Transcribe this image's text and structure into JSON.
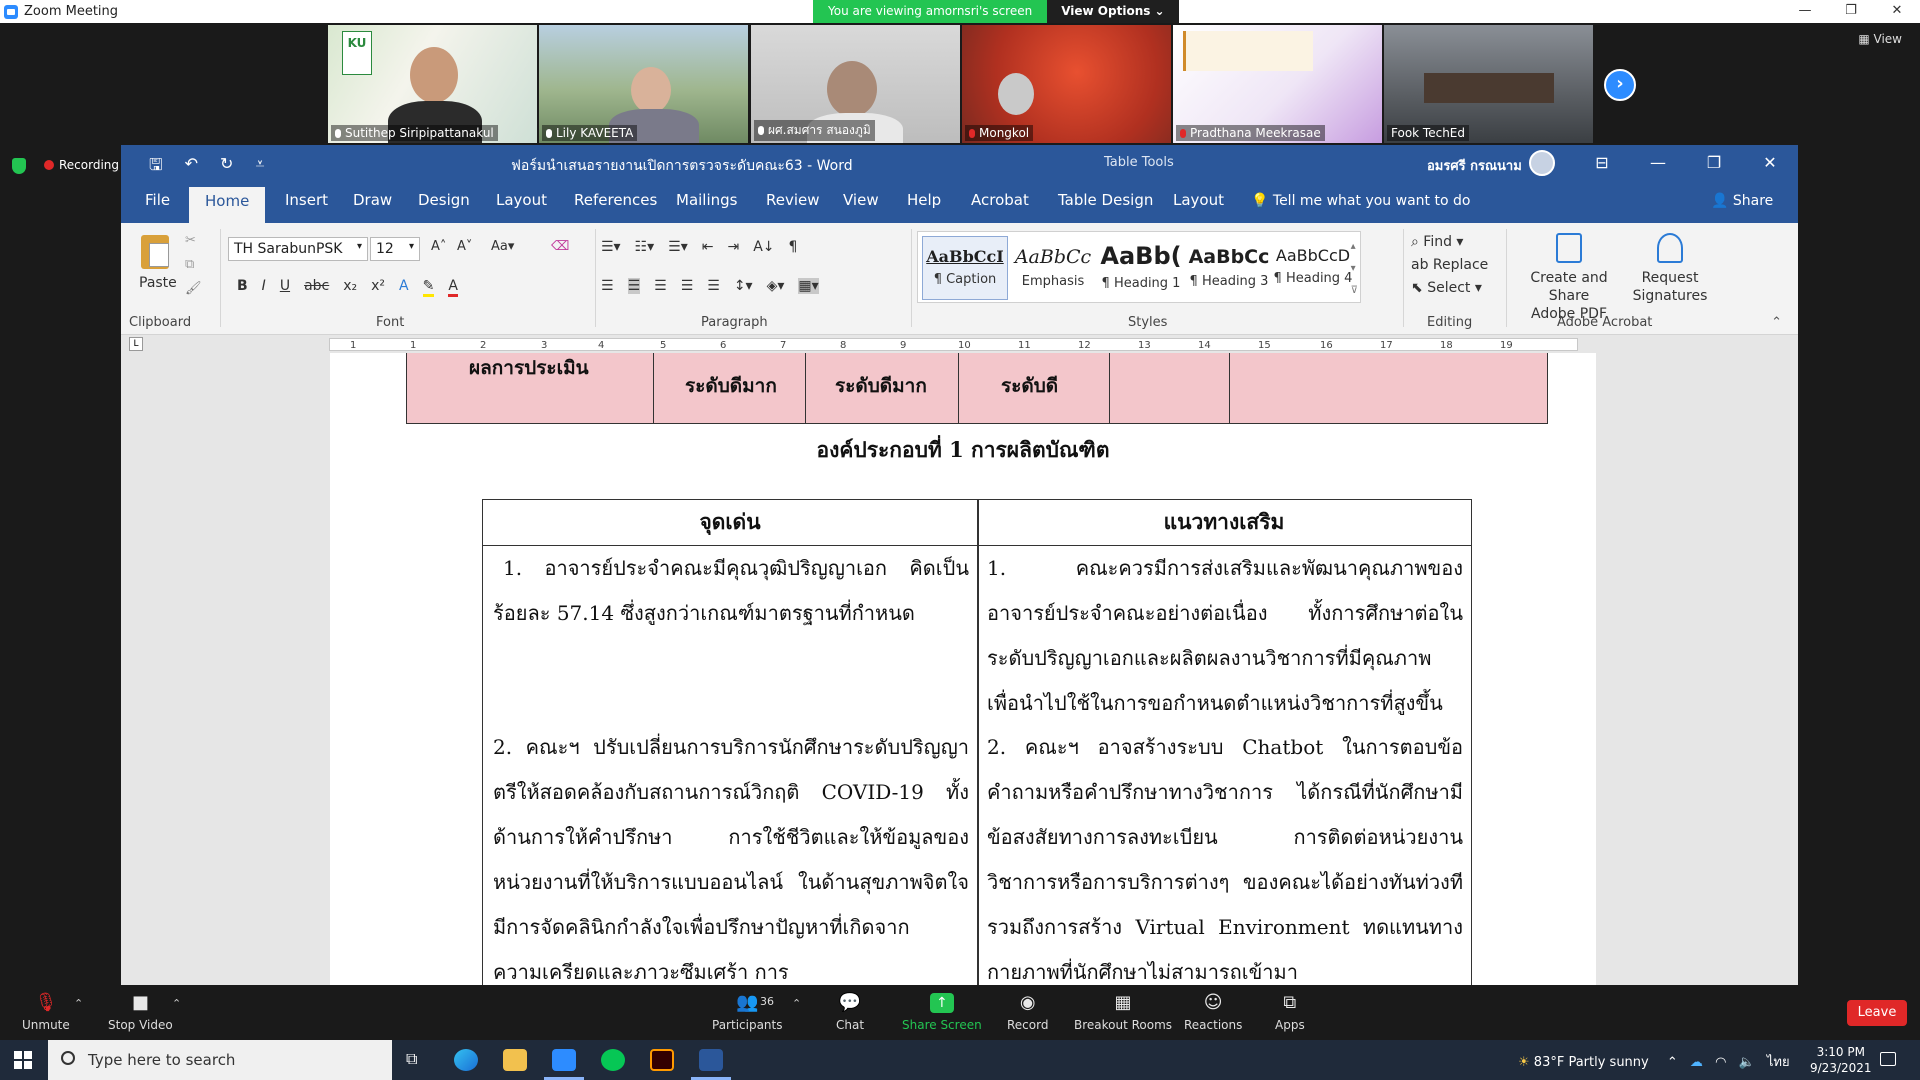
{
  "zoom": {
    "window_title": "Zoom Meeting",
    "banner_text": "You are viewing amornsri's screen",
    "view_options_label": "View Options ⌄",
    "view_label": "View",
    "recording_label": "Recording",
    "participants": [
      {
        "name": "Sutithep Siripipattanakul",
        "muted": false
      },
      {
        "name": "Lily KAVEETA",
        "muted": false
      },
      {
        "name": "ผศ.สมศาร สนองภูมิ",
        "muted": false
      },
      {
        "name": "Mongkol",
        "muted": true
      },
      {
        "name": "Pradthana Meekrasae",
        "muted": true
      },
      {
        "name": "Fook TechEd",
        "muted": false
      }
    ],
    "toolbar": {
      "unmute": "Unmute",
      "stop_video": "Stop Video",
      "participants": "Participants",
      "participants_count": "36",
      "chat": "Chat",
      "share_screen": "Share Screen",
      "record": "Record",
      "breakout_rooms": "Breakout Rooms",
      "reactions": "Reactions",
      "apps": "Apps",
      "leave": "Leave"
    }
  },
  "word": {
    "doc_title": "ฟอร์มนำเสนอรายงานเปิดการตรวจระดับคณะ63 - Word",
    "table_tools": "Table Tools",
    "user_name": "อมรศรี กรณนาม",
    "tabs": [
      "File",
      "Home",
      "Insert",
      "Draw",
      "Design",
      "Layout",
      "References",
      "Mailings",
      "Review",
      "View",
      "Help",
      "Acrobat",
      "Table Design",
      "Layout"
    ],
    "tell_me": "Tell me what you want to do",
    "share": "Share",
    "ribbon": {
      "paste": "Paste",
      "clipboard": "Clipboard",
      "font_name": "TH SarabunPSK",
      "font_size": "12",
      "font": "Font",
      "paragraph": "Paragraph",
      "styles": "Styles",
      "editing": "Editing",
      "adobe_acrobat": "Adobe Acrobat",
      "style_items": [
        {
          "sample": "AaBbCcI",
          "name": "¶ Caption"
        },
        {
          "sample": "AaBbCc",
          "name": "Emphasis"
        },
        {
          "sample": "AaBb(",
          "name": "¶ Heading 1"
        },
        {
          "sample": "AaBbCc",
          "name": "¶ Heading 3"
        },
        {
          "sample": "AaBbCcD",
          "name": "¶ Heading 4"
        }
      ],
      "find": "Find",
      "replace": "Replace",
      "select": "Select",
      "create_share_pdf_1": "Create and Share",
      "create_share_pdf_2": "Adobe PDF",
      "request_sig_1": "Request",
      "request_sig_2": "Signatures"
    },
    "ruler_ticks": [
      "1",
      "1",
      "2",
      "3",
      "4",
      "5",
      "6",
      "7",
      "8",
      "9",
      "10",
      "11",
      "12",
      "13",
      "14",
      "15",
      "16",
      "17",
      "18",
      "19"
    ],
    "document": {
      "top_row": {
        "label": "ผลการประเมิน",
        "c1": "ระดับดีมาก",
        "c2": "ระดับดีมาก",
        "c3": "ระดับดี"
      },
      "heading": "องค์ประกอบที่ 1 การผลิตบัณฑิต",
      "col_strengths": "จุดเด่น",
      "col_improvements": "แนวทางเสริม",
      "strength_1": "1. อาจารย์ประจำคณะมีคุณวุฒิปริญญาเอก คิดเป็นร้อยละ 57.14 ซึ่งสูงกว่าเกณฑ์มาตรฐานที่กำหนด",
      "strength_2": "2. คณะฯ ปรับเปลี่ยนการบริการนักศึกษาระดับปริญญาตรีให้สอดคล้องกับสถานการณ์วิกฤติ COVID-19 ทั้งด้านการให้คำปรึกษา การใช้ชีวิตและให้ข้อมูลของหน่วยงานที่ให้บริการแบบออนไลน์ ในด้านสุขภาพจิตใจมีการจัดคลินิกกำลังใจเพื่อปรึกษาปัญหาที่เกิดจากความเครียดและภาวะซึมเศร้า การ",
      "improve_1": "1. คณะควรมีการส่งเสริมและพัฒนาคุณภาพของอาจารย์ประจำคณะอย่างต่อเนื่อง ทั้งการศึกษาต่อในระดับปริญญาเอกและผลิตผลงานวิชาการที่มีคุณภาพเพื่อนำไปใช้ในการขอกำหนดตำแหน่งวิชาการที่สูงขึ้น",
      "improve_2": "2. คณะฯ อาจสร้างระบบ Chatbot ในการตอบข้อคำถามหรือคำปรึกษาทางวิชาการ ได้กรณีที่นักศึกษามีข้อสงสัยทางการลงทะเบียน การติดต่อหน่วยงานวิชาการหรือการบริการต่างๆ ของคณะได้อย่างทันท่วงที รวมถึงการสร้าง Virtual Environment ทดแทนทางกายภาพที่นักศึกษาไม่สามารถเข้ามา"
    }
  },
  "taskbar": {
    "search_placeholder": "Type here to search",
    "weather": "83°F  Partly sunny",
    "language": "ไทย",
    "time": "3:10 PM",
    "date": "9/23/2021"
  }
}
